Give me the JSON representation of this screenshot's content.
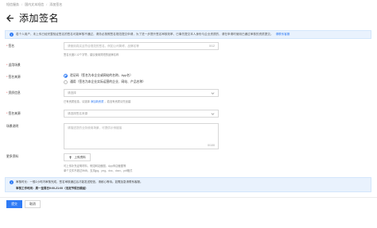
{
  "breadcrumb": [
    "短信服务",
    "国内文本短信",
    "添加签名"
  ],
  "page_title": "添加签名",
  "notice": {
    "text": "若个人用户，未上传已经完整验证签名的签名可能审核不通过，请务必按照签名规范提交申请，为了进一步提升签名审核效率，已事先提交本人身份与企业资质的，请在申请时使用已通过审核的资质提交。",
    "link": "请联系客服"
  },
  "fields": {
    "sign_name": {
      "label": "签名",
      "placeholder": "请使用真实且符合规范的签名，例如公司简称、品牌名等",
      "counter": "0/12",
      "help": "签名长度2-12个字符，建议使用简短的品牌名称"
    },
    "app_scene": {
      "label": "适用场景"
    },
    "sign_source": {
      "label": "签名来源",
      "options": [
        {
          "label": "验证码（签名为本企业或网站的名称，App名）",
          "checked": true
        },
        {
          "label": "通用（签名为本企业实际运营的企业、网站、产品名称）",
          "checked": false
        }
      ]
    },
    "qualification": {
      "label": "资质信息",
      "placeholder": "请选择",
      "help_prefix": "已有资质信息，请选择",
      "help_link": "添加新资质",
      "help_suffix": "，若没有资质请先创建"
    },
    "verification": {
      "label": "签名来源",
      "placeholder": "请选择签名来源"
    },
    "description": {
      "label": "场景说明",
      "placeholder": "请描述您的业务使用场景，可提供示例链接",
      "counter": "0/100"
    },
    "more_info": {
      "label": "更多资料",
      "upload_label": "上传资料",
      "help1": "可上传补充证明材料，例如网站截图、App商店截图等",
      "help2": "单个文件不超过5MB，支持jpg、png、doc、docx、pdf格式"
    }
  },
  "warning": {
    "line1": "审核时长：一般2小时内审核完成，签名审核通过后才能发送短信，请耐心等待。如需加急请联系客服。",
    "line2": "审核工作时间：周一至周日9:00-21:00（法定节假日顺延）"
  },
  "buttons": {
    "submit": "提交",
    "cancel": "取消"
  },
  "colors": {
    "primary": "#2f7bf5",
    "notice_bg": "#e9f2fd",
    "required": "#e54545"
  }
}
